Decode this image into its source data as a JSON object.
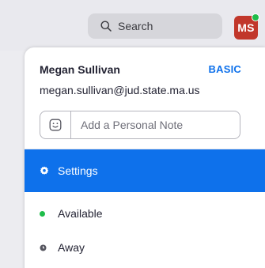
{
  "header": {
    "search": {
      "label": "Search"
    },
    "avatar": {
      "initials": "MS",
      "color": "#c1372b",
      "presence_color": "#1fbd4a"
    }
  },
  "profile": {
    "name": "Megan Sullivan",
    "plan": "BASIC",
    "email": "megan.sullivan@jud.state.ma.us",
    "note_placeholder": "Add a Personal Note"
  },
  "menu": {
    "settings": {
      "label": "Settings",
      "icon": "gear-icon",
      "active": true,
      "color": "#0e71eb"
    },
    "available": {
      "label": "Available",
      "color": "#1fbd4a"
    },
    "away": {
      "label": "Away",
      "icon": "clock-icon"
    }
  }
}
